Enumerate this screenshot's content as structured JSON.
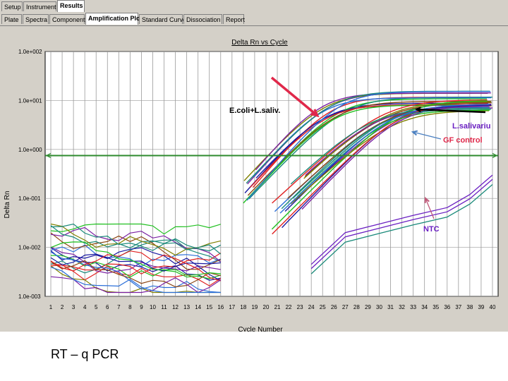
{
  "tabs_row1": [
    "Setup",
    "Instrument",
    "Results"
  ],
  "tabs_row1_active": "Results",
  "tabs_row2": [
    "Plate",
    "Spectra",
    "Component",
    "Amplification Plot",
    "Standard Curve",
    "Dissociation",
    "Report"
  ],
  "tabs_row2_active": "Amplification Plot",
  "caption": "RT – q PCR",
  "chart_data": {
    "type": "line",
    "title": "Delta Rn vs Cycle",
    "xlabel": "Cycle Number",
    "ylabel": "Delta Rn",
    "y_scale": "log",
    "ylim": [
      0.001,
      100
    ],
    "xlim": [
      1,
      40
    ],
    "y_tick_labels": [
      "1.0e+002",
      "1.0e+001",
      "1.0e+000",
      "1.0e-001",
      "1.0e-002",
      "1.0e-003"
    ],
    "x_tick_labels": [
      "1",
      "2",
      "3",
      "4",
      "5",
      "6",
      "7",
      "8",
      "9",
      "10",
      "11",
      "12",
      "13",
      "14",
      "15",
      "16",
      "17",
      "18",
      "19",
      "20",
      "21",
      "22",
      "23",
      "24",
      "25",
      "26",
      "27",
      "28",
      "29",
      "30",
      "31",
      "32",
      "33",
      "34",
      "35",
      "36",
      "37",
      "38",
      "39",
      "40"
    ],
    "grid": true,
    "threshold": 0.75,
    "threshold_color": "#2e8b2e",
    "series_colors": [
      "#1a1aa0",
      "#e02020",
      "#20c020",
      "#7a1fa2",
      "#1a8a7a",
      "#2b6fd8",
      "#8b4513",
      "#808000"
    ],
    "groups": [
      {
        "label": "E.coli+L.saliv.",
        "count": 14,
        "plateau_range": [
          8,
          16
        ],
        "ct_range": [
          20.0,
          22.6
        ]
      },
      {
        "label": "L.salivariu",
        "count": 10,
        "plateau_range": [
          7,
          11
        ],
        "ct_range": [
          25.0,
          27.5
        ]
      },
      {
        "label": "GF control",
        "count": 8,
        "plateau_range": [
          6,
          9
        ],
        "ct_range": [
          25.8,
          28.5
        ]
      },
      {
        "label": "NTC",
        "count": 3,
        "points": [
          [
            24,
            0.0045
          ],
          [
            27,
            0.02
          ],
          [
            30,
            0.03
          ],
          [
            33,
            0.045
          ],
          [
            36,
            0.065
          ],
          [
            38,
            0.12
          ],
          [
            40,
            0.3
          ]
        ]
      }
    ],
    "annotations": [
      {
        "text": "E.coli+L.saliv.",
        "color": "#000000",
        "arrow_color": "#e0284a"
      },
      {
        "text": "L.salivariu",
        "color": "#6a1fc2",
        "arrow_color": "#000000"
      },
      {
        "text": "GF control",
        "color": "#e0284a",
        "arrow_color": "#4a7fc0"
      },
      {
        "text": "NTC",
        "color": "#6a1fc2",
        "arrow_color": "#c05a7a"
      }
    ]
  }
}
